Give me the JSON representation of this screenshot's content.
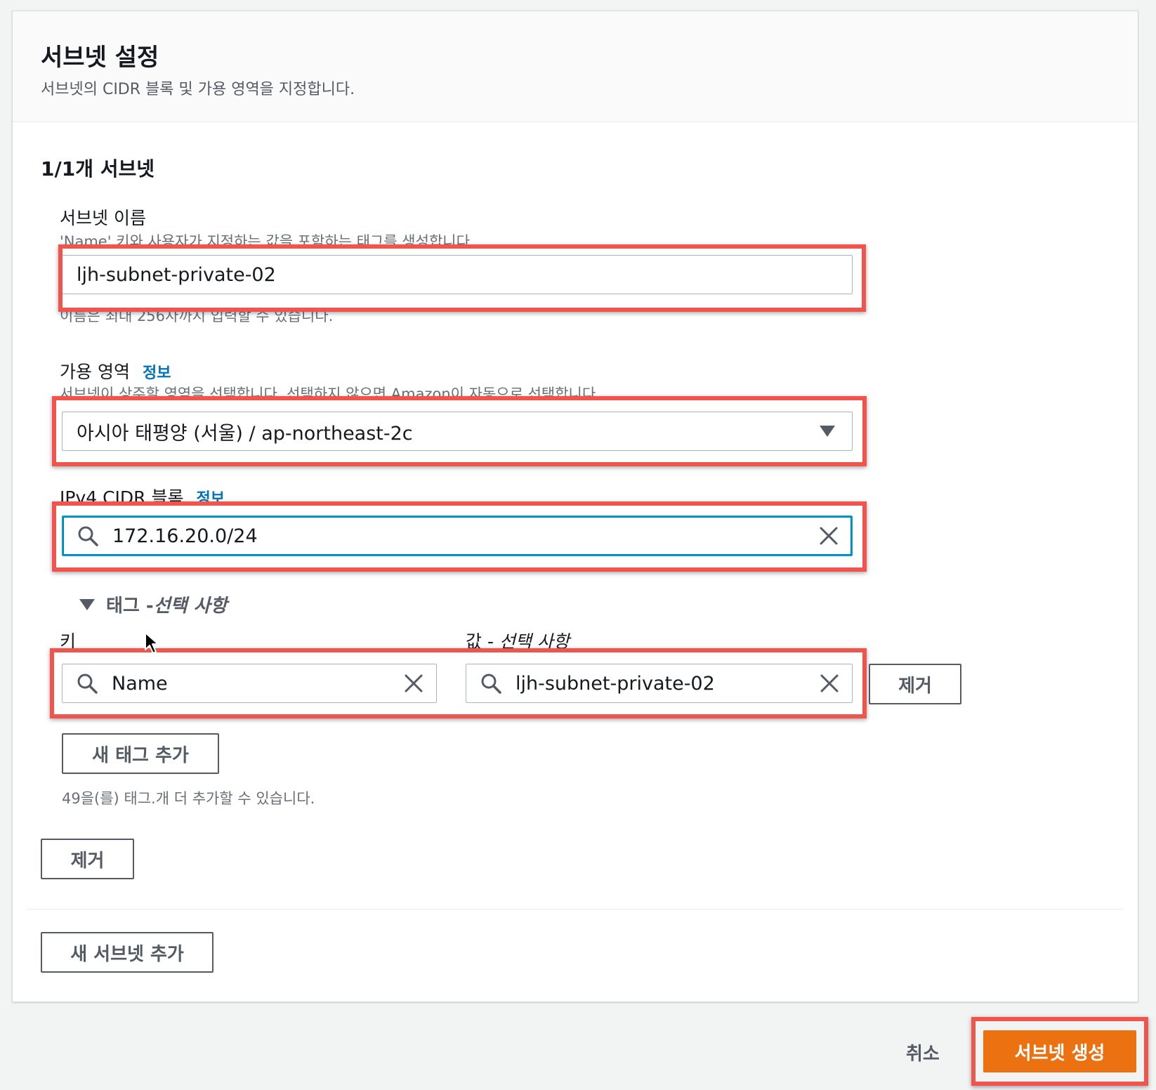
{
  "panel": {
    "title": "서브넷 설정",
    "description": "서브넷의 CIDR 블록 및 가용 영역을 지정합니다."
  },
  "subnet": {
    "count_label": "1/1개 서브넷",
    "name": {
      "label": "서브넷 이름",
      "description": "'Name' 키와 사용자가 지정하는 값을 포함하는 태그를 생성합니다.",
      "value": "ljh-subnet-private-02",
      "hint": "이름은 최대 256자까지 입력할 수 있습니다."
    },
    "az": {
      "label": "가용 영역",
      "info": "정보",
      "description": "서브넷이 상주할 영역을 선택합니다. 선택하지 않으면 Amazon이 자동으로 선택합니다.",
      "value": "아시아 태평양 (서울) / ap-northeast-2c"
    },
    "cidr": {
      "label": "IPv4 CIDR 블록",
      "info": "정보",
      "value": "172.16.20.0/24"
    },
    "tags": {
      "toggle_label": "태그 - ",
      "toggle_optional": "선택 사항",
      "key_label": "키",
      "value_label": "값 - ",
      "value_optional": "선택 사항",
      "key_value": "Name",
      "value_value": "ljh-subnet-private-02",
      "remove_label": "제거",
      "add_label": "새 태그 추가",
      "remaining_text": "49을(를) 태그.개 더 추가할 수 있습니다."
    },
    "remove_subnet_label": "제거"
  },
  "add_subnet_label": "새 서브넷 추가",
  "footer": {
    "cancel_label": "취소",
    "create_label": "서브넷 생성"
  },
  "colors": {
    "accent_primary": "#ec7211",
    "highlight": "#f0544d",
    "link": "#0073bb",
    "focus": "#00a1c9"
  }
}
